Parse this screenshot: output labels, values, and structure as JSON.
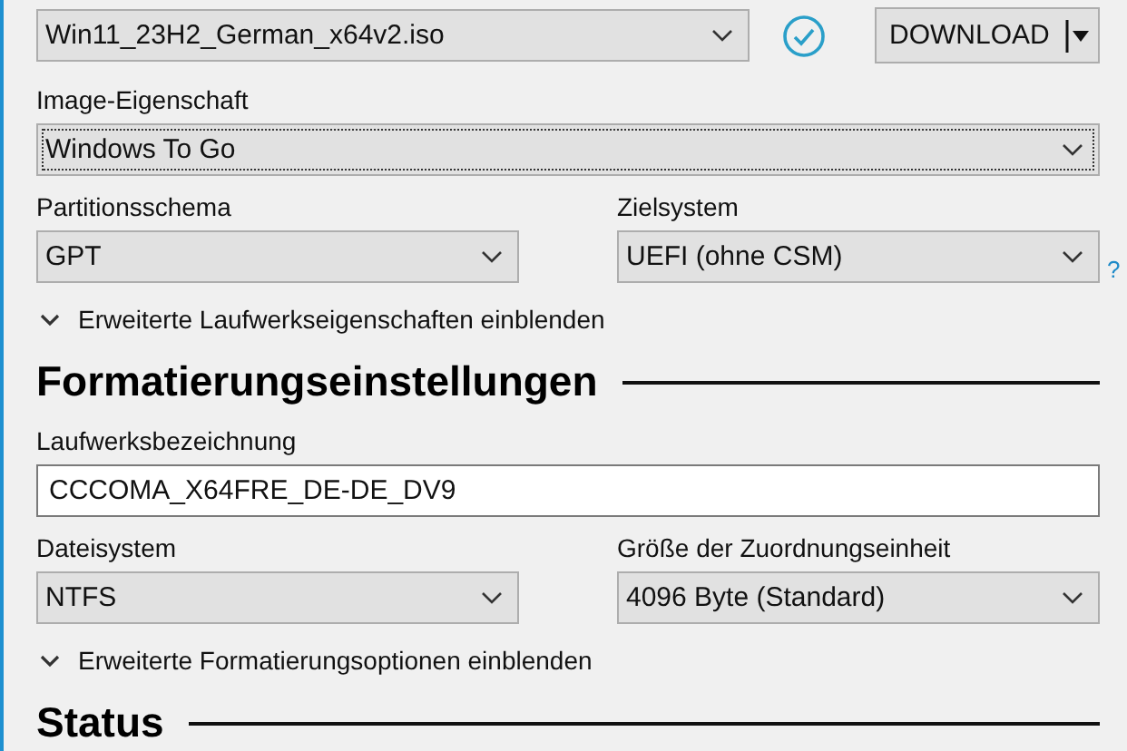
{
  "boot_selection": {
    "value": "Win11_23H2_German_x64v2.iso",
    "focused": false
  },
  "download_button": {
    "label": "DOWNLOAD"
  },
  "image_option": {
    "label": "Image-Eigenschaft",
    "value": "Windows To Go",
    "focused": true
  },
  "partition_scheme": {
    "label": "Partitionsschema",
    "value": "GPT",
    "focused": false
  },
  "target_system": {
    "label": "Zielsystem",
    "value": "UEFI (ohne CSM)",
    "focused": false,
    "help": "?"
  },
  "drive_expander": {
    "label": "Erweiterte Laufwerkseigenschaften einblenden",
    "expanded": false
  },
  "format_heading": "Formatierungseinstellungen",
  "volume_label": {
    "label": "Laufwerksbezeichnung",
    "value": "CCCOMA_X64FRE_DE-DE_DV9"
  },
  "file_system": {
    "label": "Dateisystem",
    "value": "NTFS",
    "focused": false
  },
  "cluster_size": {
    "label": "Größe der Zuordnungseinheit",
    "value": "4096 Byte (Standard)",
    "focused": false
  },
  "format_expander": {
    "label": "Erweiterte Formatierungsoptionen einblenden",
    "expanded": false
  },
  "status_heading": "Status"
}
